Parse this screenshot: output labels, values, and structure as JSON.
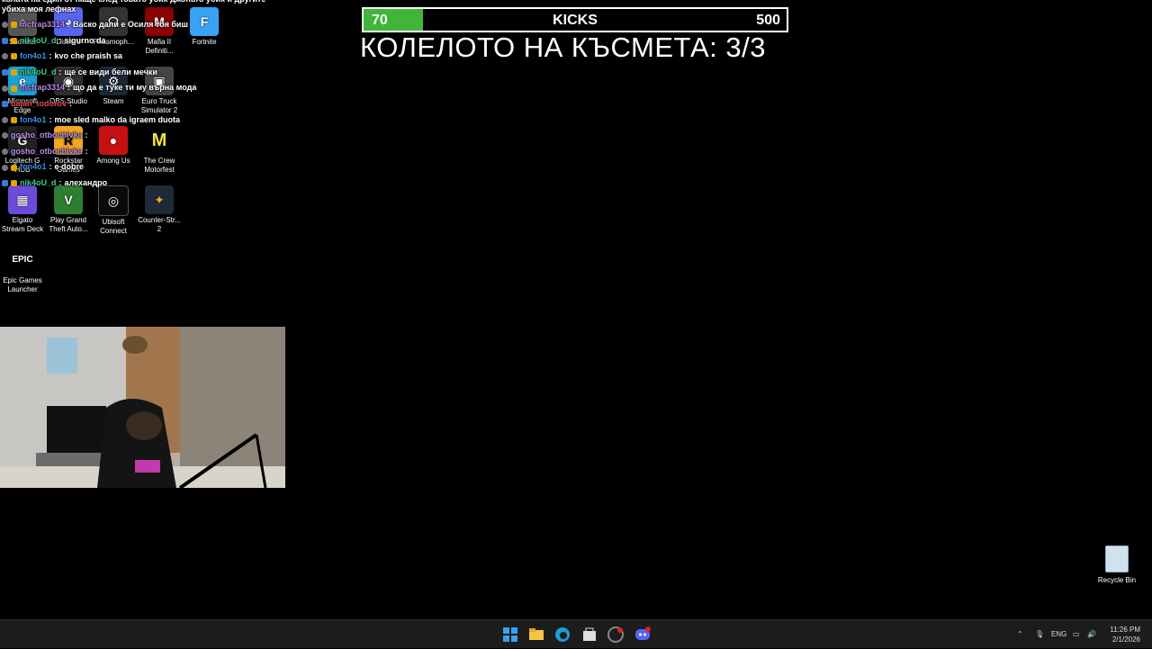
{
  "desktop_icons": [
    {
      "label": "Shortcut",
      "name": "shortcut-icon",
      "color": "#555555",
      "glyph": ""
    },
    {
      "label": "Discord",
      "name": "discord-icon",
      "color": "#5865f2",
      "glyph": "◕"
    },
    {
      "label": "Phasmoph...",
      "name": "phasmophobia-icon",
      "color": "#333333",
      "glyph": "☊"
    },
    {
      "label": "Mafia II Definiti...",
      "name": "mafia-icon",
      "color": "#8b0000",
      "glyph": "M"
    },
    {
      "label": "Fortnite",
      "name": "fortnite-icon",
      "color": "#38a3f5",
      "glyph": "F"
    },
    {
      "label": "Microsoft Edge",
      "name": "edge-icon",
      "color": "#1a9fd4",
      "glyph": "e"
    },
    {
      "label": "OBS Studio",
      "name": "obs-icon",
      "color": "#302e31",
      "glyph": "◉"
    },
    {
      "label": "Steam",
      "name": "steam-icon",
      "color": "#1b2838",
      "glyph": "⚙"
    },
    {
      "label": "Euro Truck Simulator 2",
      "name": "euro-truck-icon",
      "color": "#444444",
      "glyph": "▣"
    },
    {
      "label": "Logitech G HUB",
      "name": "logitech-icon",
      "color": "#222222",
      "glyph": "G"
    },
    {
      "label": "Rockstar Games",
      "name": "rockstar-icon",
      "color": "#f5a623",
      "glyph": "R"
    },
    {
      "label": "Among Us",
      "name": "among-us-icon",
      "color": "#c51111",
      "glyph": "●"
    },
    {
      "label": "The Crew Motorfest",
      "name": "crew-icon",
      "color": "#000000",
      "glyph": "M"
    },
    {
      "label": "Elgato Stream Deck",
      "name": "elgato-icon",
      "color": "#6c4bd8",
      "glyph": "▦"
    },
    {
      "label": "Play Grand Theft Auto...",
      "name": "gta-icon",
      "color": "#2e7d32",
      "glyph": "V"
    },
    {
      "label": "Ubisoft Connect",
      "name": "ubisoft-icon",
      "color": "#0a0a0a",
      "glyph": "◎"
    },
    {
      "label": "Counter-Str... 2",
      "name": "counter-strike-icon",
      "color": "#1e2a3a",
      "glyph": "✦"
    },
    {
      "label": "Epic Games Launcher",
      "name": "epic-games-icon",
      "color": "#000000",
      "glyph": "EPIC"
    }
  ],
  "chat": [
    {
      "user": "",
      "text": "колата на един от наще след товато убих джоньто убих и другите убиха моя лефнах",
      "user_color": "#ffffff"
    },
    {
      "user": "mcfrap3314",
      "text": "Васко дали е Осиля тоя биш",
      "user_color": "#b48ce6"
    },
    {
      "user": "nik4oU_d",
      "text": "sigurno da",
      "user_color": "#3ad18a"
    },
    {
      "user": "fon4o1",
      "text": "kvo che praish sa",
      "user_color": "#3a8fe6"
    },
    {
      "user": "nik4oU_d",
      "text": "ще се види бели мечки",
      "user_color": "#3ad18a"
    },
    {
      "user": "mcfrap3314",
      "text": "що да е туке ти му върна мода",
      "user_color": "#b48ce6"
    },
    {
      "user": "dajan_todorov",
      "text": "",
      "user_color": "#e24a4a"
    },
    {
      "user": "fon4o1",
      "text": "moe sled malko da igraem duota",
      "user_color": "#3a8fe6"
    },
    {
      "user": "gosho_otbochivka",
      "text": "",
      "user_color": "#b48ce6"
    },
    {
      "user": "gosho_otbochivka",
      "text": "",
      "user_color": "#b48ce6"
    },
    {
      "user": "fon4o1",
      "text": "e dobre",
      "user_color": "#3a8fe6"
    },
    {
      "user": "nik4oU_d",
      "text": "алехандро",
      "user_color": "#3ad18a"
    }
  ],
  "kicks_bar": {
    "current": "70",
    "title": "KICKS",
    "goal": "500",
    "progress_fraction": 0.14,
    "fill_color": "#3fb53a"
  },
  "wheel_title": "КОЛЕЛОТО НА КЪСМЕТА: 3/3",
  "recycle_bin": {
    "label": "Recycle Bin"
  },
  "taskbar": {
    "apps": [
      {
        "name": "start-icon",
        "color": "#3aa0f0"
      },
      {
        "name": "file-explorer-icon",
        "color": "#f5c542"
      },
      {
        "name": "edge-taskbar-icon",
        "color": "#1a9fd4"
      },
      {
        "name": "store-icon",
        "color": "#dddddd"
      },
      {
        "name": "obs-taskbar-icon",
        "color": "#888888"
      },
      {
        "name": "discord-taskbar-icon",
        "color": "#5865f2"
      }
    ],
    "tray": {
      "language": "ENG",
      "time": "11:26 PM",
      "date": "2/1/2026"
    }
  }
}
